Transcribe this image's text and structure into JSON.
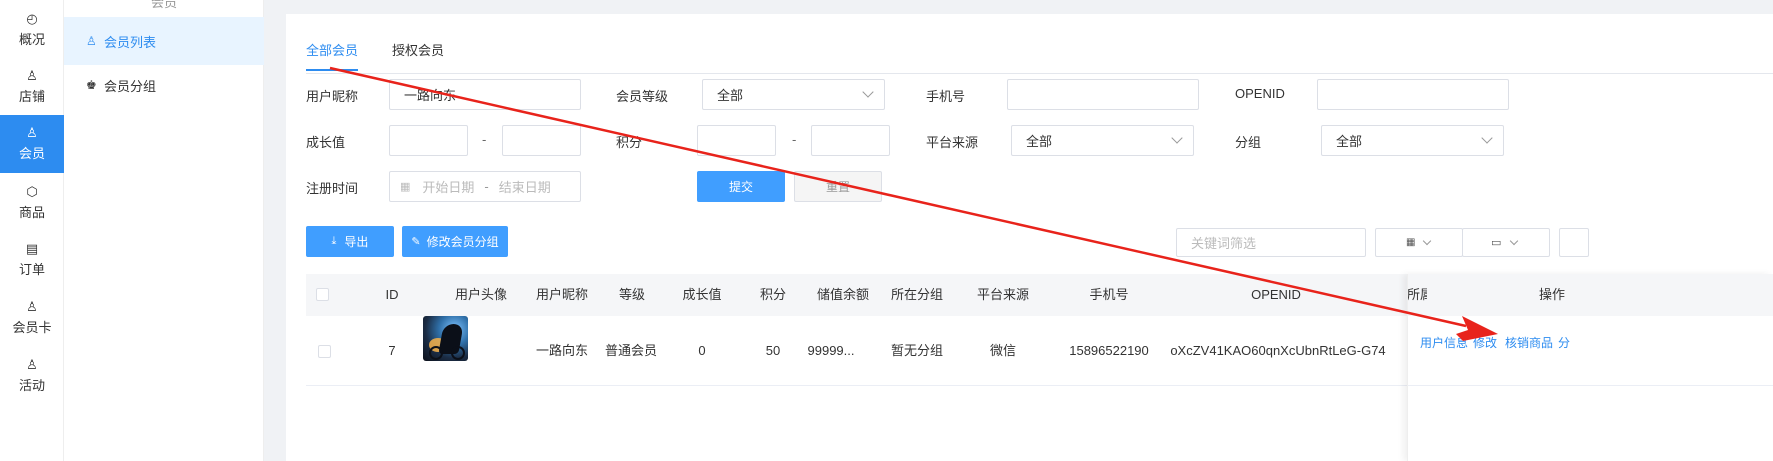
{
  "nav": {
    "items": [
      {
        "icon": "dashboard-icon",
        "glyph": "◴",
        "label": "概况"
      },
      {
        "icon": "store-icon",
        "glyph": "♙",
        "label": "店铺"
      },
      {
        "icon": "member-icon",
        "glyph": "♙",
        "label": "会员",
        "active": true
      },
      {
        "icon": "product-icon",
        "glyph": "⬡",
        "label": "商品"
      },
      {
        "icon": "order-icon",
        "glyph": "▤",
        "label": "订单"
      },
      {
        "icon": "member-card-icon",
        "glyph": "♙",
        "label": "会员卡"
      },
      {
        "icon": "activity-icon",
        "glyph": "♙",
        "label": "活动"
      }
    ]
  },
  "subnav": {
    "title": "会员",
    "items": [
      {
        "icon": "user-icon",
        "glyph": "♙",
        "label": "会员列表",
        "active": true
      },
      {
        "icon": "users-icon",
        "glyph": "♚",
        "label": "会员分组"
      }
    ]
  },
  "tabs": [
    "全部会员",
    "授权会员"
  ],
  "filters": {
    "nickname_label": "用户昵称",
    "nickname_value": "一路向东",
    "level_label": "会员等级",
    "level_value": "全部",
    "phone_label": "手机号",
    "phone_value": "",
    "openid_label": "OPENID",
    "openid_value": "",
    "growth_label": "成长值",
    "points_label": "积分",
    "range_sep": "-",
    "platform_label": "平台来源",
    "platform_value": "全部",
    "group_label": "分组",
    "group_value": "全部",
    "regtime_label": "注册时间",
    "start_placeholder": "开始日期",
    "end_placeholder": "结束日期",
    "submit": "提交",
    "reset": "重置"
  },
  "toolbar": {
    "export": "导出",
    "edit_group": "修改会员分组",
    "keyword_placeholder": "关键词筛选"
  },
  "table": {
    "headers": [
      "ID",
      "用户头像",
      "用户昵称",
      "等级",
      "成长值",
      "积分",
      "储值余额",
      "所在分组",
      "平台来源",
      "手机号",
      "OPENID",
      "所属",
      "操作"
    ],
    "rows": [
      {
        "id": "7",
        "nickname": "一路向东",
        "level": "普通会员",
        "growth": "0",
        "points": "50",
        "balance": "99999...",
        "group": "暂无分组",
        "platform": "微信",
        "phone": "15896522190",
        "openid": "oXcZV41KAO60qnXcUbnRtLeG-G74",
        "actions": [
          "用户信息",
          "修改",
          "核销商品",
          "分"
        ]
      }
    ]
  },
  "colors": {
    "accent": "#2d8cf0",
    "button": "#409eff",
    "arrow": "#e8231b"
  }
}
